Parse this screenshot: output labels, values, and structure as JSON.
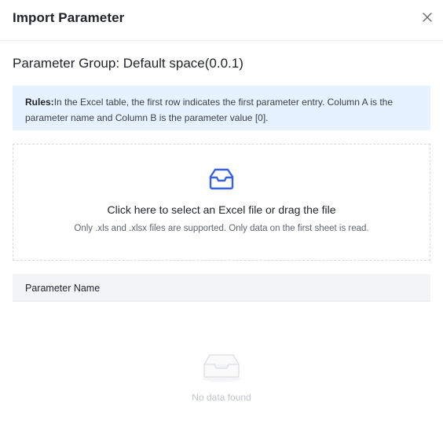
{
  "dialog": {
    "title": "Import Parameter",
    "close_icon": "close-icon"
  },
  "group": {
    "title": "Parameter Group: Default space(0.0.1)"
  },
  "rules": {
    "label": "Rules:",
    "text": "In the Excel table, the first row indicates the first parameter entry. Column A is the parameter name and Column B is the parameter value [0]."
  },
  "upload": {
    "icon": "inbox-icon",
    "main_text": "Click here to select an Excel file or drag the file",
    "sub_text": "Only .xls and .xlsx files are supported. Only data on the first sheet is read."
  },
  "table": {
    "columns": [
      "Parameter Name"
    ],
    "rows": [],
    "empty_icon": "empty-inbox-icon",
    "empty_text": "No data found"
  },
  "colors": {
    "accent": "#3560e8",
    "info_bg": "#e6f2ff",
    "table_header_bg": "#f3f4f6"
  }
}
